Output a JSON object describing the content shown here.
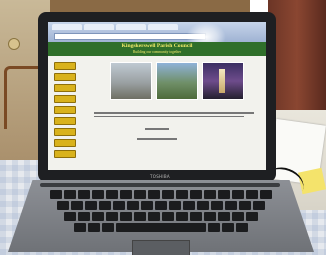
{
  "photo": {
    "brand_label": "TOSHIBA"
  },
  "web_page": {
    "title": "Kingskerswell Parish Council",
    "subtitle": "Building our community together"
  },
  "colors": {
    "header_green": "#2f6f2a",
    "title_yellow": "#f2ea6a",
    "nav_button_gold": "#d9b21c"
  }
}
